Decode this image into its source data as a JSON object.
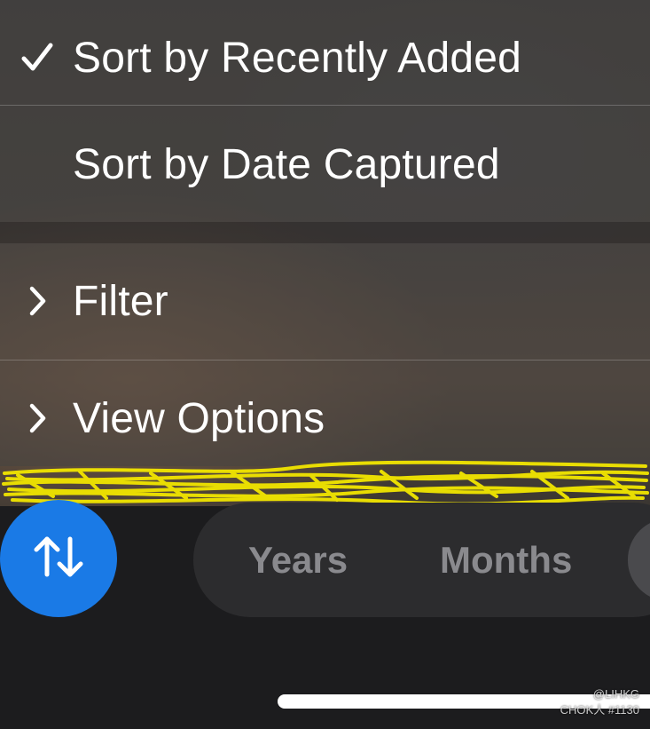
{
  "menu": {
    "sort_options": [
      {
        "label": "Sort by Recently Added",
        "selected": true,
        "icon": "checkmark-icon"
      },
      {
        "label": "Sort by Date Captured",
        "selected": false
      }
    ],
    "more_options": [
      {
        "label": "Filter",
        "icon": "chevron-right-icon"
      },
      {
        "label": "View Options",
        "icon": "chevron-right-icon"
      }
    ]
  },
  "toolbar": {
    "sort_button_icon": "sort-arrows-icon",
    "segments": [
      {
        "label": "Years"
      },
      {
        "label": "Months"
      }
    ]
  },
  "watermark": {
    "line1": "@LIHKG",
    "line2": "CHOK人 #1130"
  },
  "colors": {
    "accent": "#1a7ae6",
    "redaction": "#f2e600"
  }
}
